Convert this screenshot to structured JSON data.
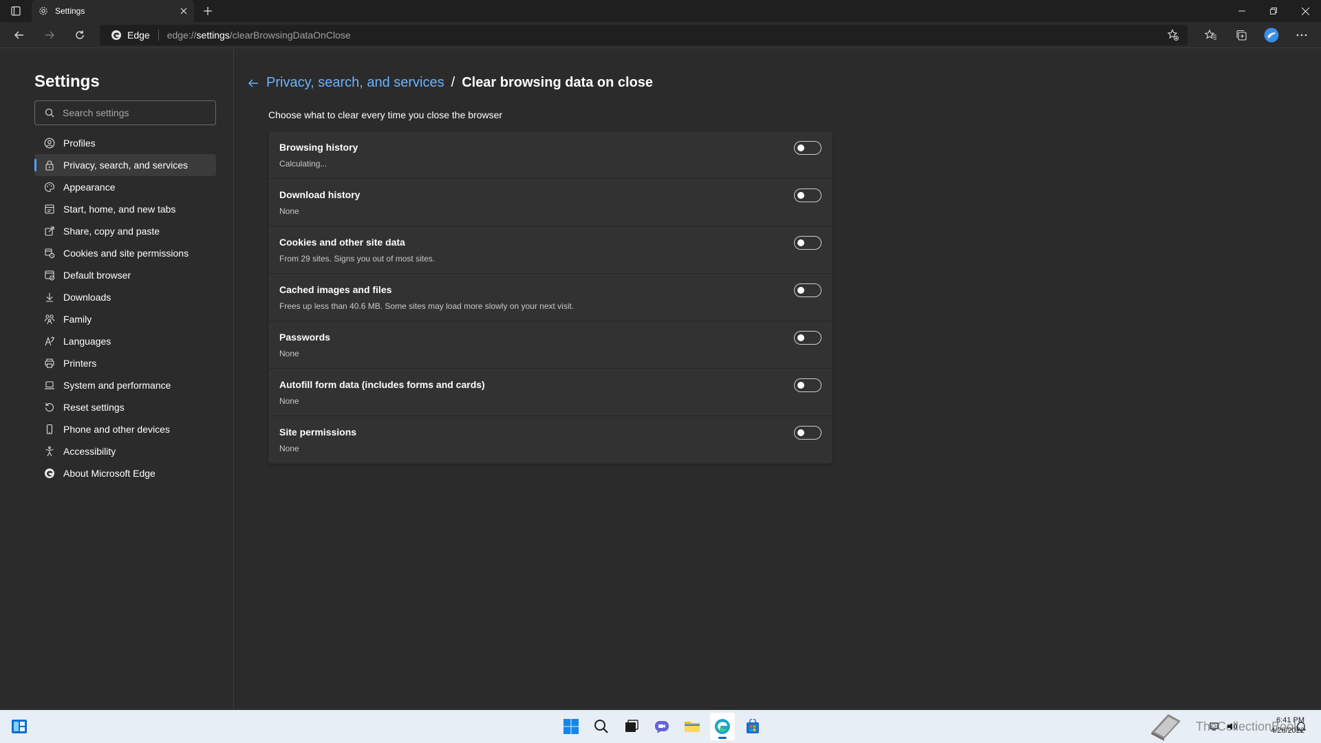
{
  "browser": {
    "tab_title": "Settings",
    "address_brand": "Edge",
    "address_url_prefix": "edge://",
    "address_url_highlight": "settings",
    "address_url_suffix": "/clearBrowsingDataOnClose"
  },
  "sidebar": {
    "title": "Settings",
    "search_placeholder": "Search settings",
    "items": [
      {
        "label": "Profiles",
        "icon": "profile-icon"
      },
      {
        "label": "Privacy, search, and services",
        "icon": "lock-icon",
        "active": true
      },
      {
        "label": "Appearance",
        "icon": "appearance-icon"
      },
      {
        "label": "Start, home, and new tabs",
        "icon": "home-tabs-icon"
      },
      {
        "label": "Share, copy and paste",
        "icon": "share-icon"
      },
      {
        "label": "Cookies and site permissions",
        "icon": "cookies-icon"
      },
      {
        "label": "Default browser",
        "icon": "browser-icon"
      },
      {
        "label": "Downloads",
        "icon": "download-icon"
      },
      {
        "label": "Family",
        "icon": "family-icon"
      },
      {
        "label": "Languages",
        "icon": "languages-icon"
      },
      {
        "label": "Printers",
        "icon": "printer-icon"
      },
      {
        "label": "System and performance",
        "icon": "laptop-icon"
      },
      {
        "label": "Reset settings",
        "icon": "reset-icon"
      },
      {
        "label": "Phone and other devices",
        "icon": "phone-icon"
      },
      {
        "label": "Accessibility",
        "icon": "accessibility-icon"
      },
      {
        "label": "About Microsoft Edge",
        "icon": "edge-logo-icon"
      }
    ]
  },
  "main": {
    "breadcrumb_parent": "Privacy, search, and services",
    "breadcrumb_separator": "/",
    "breadcrumb_current": "Clear browsing data on close",
    "intro": "Choose what to clear every time you close the browser",
    "rows": [
      {
        "title": "Browsing history",
        "subtitle": "Calculating...",
        "enabled": false
      },
      {
        "title": "Download history",
        "subtitle": "None",
        "enabled": false
      },
      {
        "title": "Cookies and other site data",
        "subtitle": "From 29 sites. Signs you out of most sites.",
        "enabled": false
      },
      {
        "title": "Cached images and files",
        "subtitle": "Frees up less than 40.6 MB. Some sites may load more slowly on your next visit.",
        "enabled": false
      },
      {
        "title": "Passwords",
        "subtitle": "None",
        "enabled": false
      },
      {
        "title": "Autofill form data (includes forms and cards)",
        "subtitle": "None",
        "enabled": false
      },
      {
        "title": "Site permissions",
        "subtitle": "None",
        "enabled": false
      }
    ]
  },
  "taskbar": {
    "apps": [
      "start-icon",
      "search-icon",
      "task-view-icon",
      "chat-icon",
      "file-explorer-icon",
      "edge-icon",
      "store-icon"
    ],
    "watermark": "TheCollectionBook",
    "time": "6:41 PM",
    "date": "4/26/2022"
  },
  "colors": {
    "accent": "#6cb4ff",
    "background": "#2b2b2b",
    "card": "#323232",
    "taskbar": "#e8eef6"
  }
}
